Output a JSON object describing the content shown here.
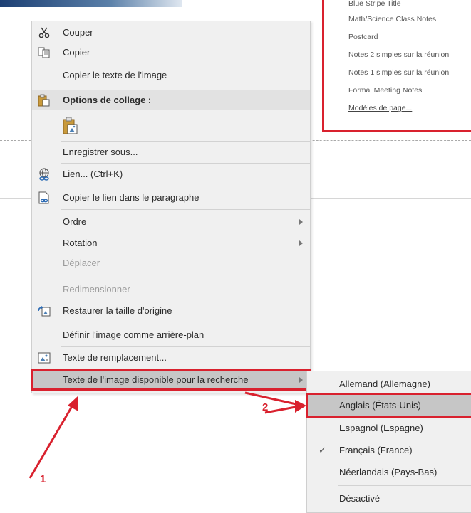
{
  "templates": {
    "items": [
      "Blue Stripe Title",
      "Math/Science Class Notes",
      "Postcard",
      "Notes 2 simples sur la réunion",
      "Notes 1 simples sur la réunion",
      "Formal Meeting Notes"
    ],
    "more_link": "Modèles de page..."
  },
  "menu": {
    "cut": "Couper",
    "copy": "Copier",
    "copy_image_text": "Copier le texte de l'image",
    "paste_options_header": "Options de collage :",
    "save_as": "Enregistrer sous...",
    "link": "Lien... (Ctrl+K)",
    "copy_link_paragraph": "Copier le lien dans le paragraphe",
    "order": "Ordre",
    "rotation": "Rotation",
    "move": "Déplacer",
    "resize": "Redimensionner",
    "restore_size": "Restaurer la taille d'origine",
    "set_background": "Définir l'image comme arrière-plan",
    "alt_text": "Texte de remplacement...",
    "searchable_text": "Texte de l'image disponible pour la recherche"
  },
  "submenu": {
    "items": [
      "Allemand (Allemagne)",
      "Anglais (États-Unis)",
      "Espagnol (Espagne)",
      "Français (France)",
      "Néerlandais (Pays-Bas)",
      "Désactivé"
    ],
    "checked_index": 3,
    "highlighted_index": 1
  },
  "annotations": {
    "label_1": "1",
    "label_2": "2",
    "color": "#d9212e"
  },
  "colors": {
    "menu_bg": "#f0f0f0",
    "highlight_bg": "#c6c6c6",
    "accent_red": "#d9212e"
  }
}
